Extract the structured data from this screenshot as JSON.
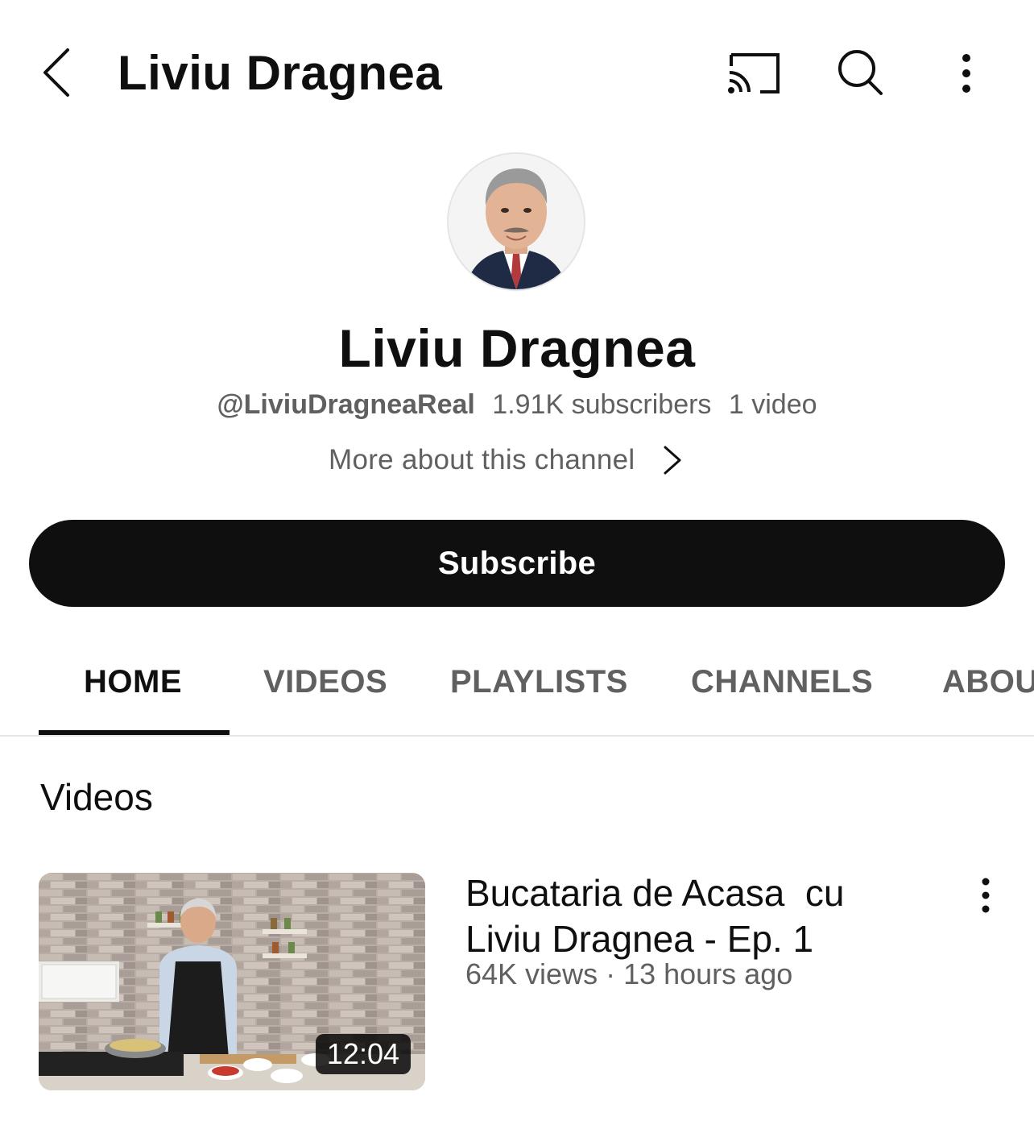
{
  "header": {
    "title": "Liviu Dragnea",
    "icons": {
      "back": "back-chevron-icon",
      "cast": "cast-icon",
      "search": "search-icon",
      "more": "more-vertical-icon"
    }
  },
  "channel": {
    "name": "Liviu Dragnea",
    "handle": "@LiviuDragneaReal",
    "subscribers": "1.91K subscribers",
    "video_count": "1 video",
    "more_about": "More about this channel",
    "subscribe_label": "Subscribe"
  },
  "tabs": [
    {
      "label": "HOME",
      "active": true
    },
    {
      "label": "VIDEOS",
      "active": false
    },
    {
      "label": "PLAYLISTS",
      "active": false
    },
    {
      "label": "CHANNELS",
      "active": false
    },
    {
      "label": "ABOU",
      "active": false
    }
  ],
  "section": {
    "title": "Videos"
  },
  "videos": [
    {
      "title": "Bucataria de Acasa  cu\nLiviu Dragnea - Ep. 1",
      "meta": "64K views · 13 hours ago",
      "duration": "12:04"
    }
  ],
  "colors": {
    "text_primary": "#0f0f0f",
    "text_secondary": "#606060",
    "subscribe_bg": "#0f0f0f",
    "divider": "#e5e5e5"
  }
}
